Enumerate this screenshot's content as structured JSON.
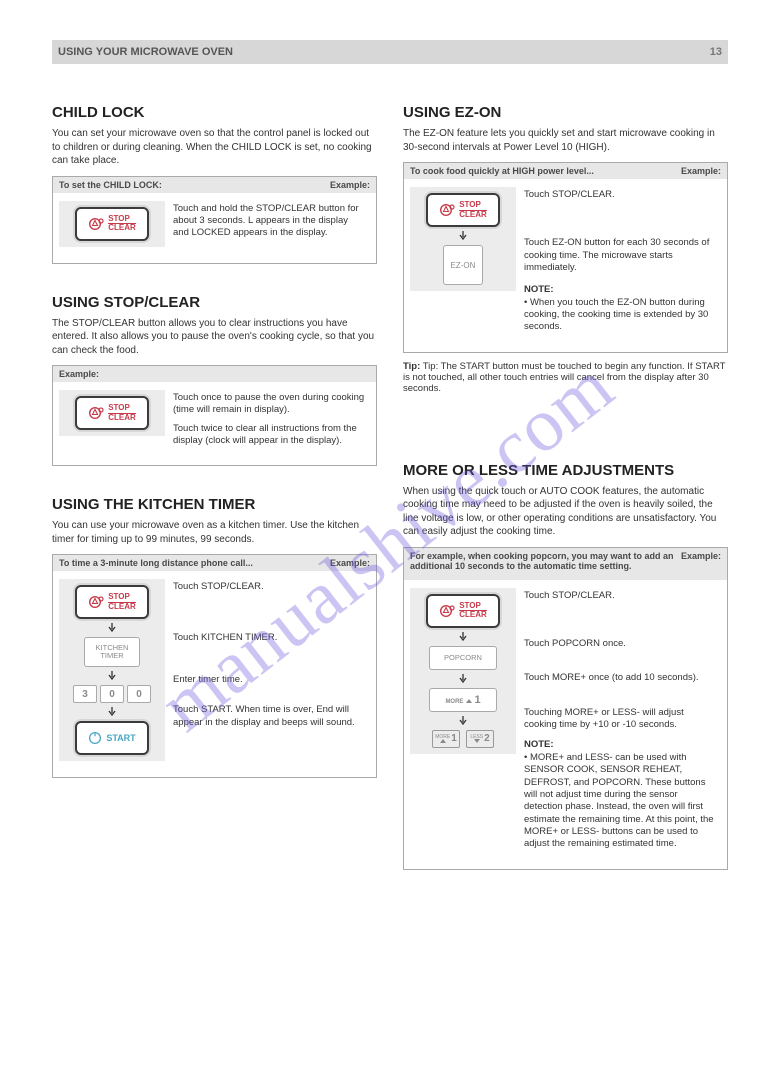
{
  "topbar": {
    "section": "USING YOUR MICROWAVE OVEN",
    "page": "13"
  },
  "watermark": "manualshive.com",
  "col1": {
    "h_child": "CHILD LOCK",
    "p_child": "You can set your microwave oven so that the control panel is locked out to children or during cleaning. When the CHILD LOCK is set, no cooking can take place.",
    "child_set": {
      "hd_l": "To set the CHILD LOCK:",
      "hd_r": "Example:",
      "body": "Touch and hold the STOP/CLEAR button for about 3 seconds. L appears in the display and LOCKED appears in the display."
    },
    "h_cancel": "USING STOP/CLEAR",
    "p_cancel": "The STOP/CLEAR button allows you to clear instructions you have entered. It also allows you to pause the oven's cooking cycle, so that you can check the food.",
    "cancel": {
      "hd_l": "Example:",
      "hd_r": "",
      "l1": "Touch once to pause the oven during cooking (time will remain in display).",
      "l2": "Touch twice to clear all instructions from the display (clock will appear in the display)."
    },
    "h_timer": "USING THE KITCHEN TIMER",
    "p_timer": "You can use your microwave oven as a kitchen timer. Use the kitchen timer for timing up to 99 minutes, 99 seconds.",
    "timer": {
      "hd_l": "To time a 3-minute long distance phone call...",
      "hd_r": "Example:",
      "s1": "Touch STOP/CLEAR.",
      "s2": "Touch KITCHEN TIMER.",
      "s3": "Enter timer time.",
      "s4": "Touch START. When time is over, End will appear in the display and beeps will sound."
    },
    "start_tip": "Tip: The START button must be touched to begin any function. If START is not touched, all other touch entries will cancel from the display after 30 seconds.",
    "btn": {
      "stop": "STOP",
      "clear": "CLEAR",
      "kitchen": "KITCHEN\nTIMER",
      "start": "START",
      "k3": "3",
      "k0a": "0",
      "k0b": "0"
    }
  },
  "col2": {
    "h_ez": "USING EZ-ON",
    "p_ez": "The EZ-ON feature lets you quickly set and start microwave cooking in 30-second intervals at Power Level 10 (HIGH).",
    "ez": {
      "hd_l": "To cook food quickly at HIGH power level...",
      "hd_r": "Example:",
      "s1": "Touch STOP/CLEAR.",
      "s2": "Touch EZ-ON button for each 30 seconds of cooking time. The microwave starts immediately.",
      "note1": "NOTE:",
      "note1b": "• When you touch the EZ-ON button during cooking, the cooking time is extended by 30 seconds."
    },
    "btn_ez": "EZ-ON",
    "h_ml": "MORE OR LESS TIME ADJUSTMENTS",
    "p_ml": "When using the quick touch or AUTO COOK features, the automatic cooking time may need to be adjusted if the oven is heavily soiled, the line voltage is low, or other operating conditions are unsatisfactory. You can easily adjust the cooking time.",
    "ml": {
      "hd_l": "For example, when cooking popcorn, you may want to add an additional 10 seconds to the automatic time setting.",
      "hd_r": "Example:",
      "s1": "Touch STOP/CLEAR.",
      "s2": "Touch POPCORN once.",
      "s3": "Touch MORE+ once (to add 10 seconds).",
      "s4": "Touching MORE+ or LESS- will adjust cooking time by +10 or -10 seconds.",
      "note": "NOTE:",
      "noteb": "• MORE+ and LESS- can be used with SENSOR COOK, SENSOR REHEAT, DEFROST, and POPCORN. These buttons will not adjust time during the sensor detection phase. Instead, the oven will first estimate the remaining time. At this point, the MORE+ or LESS- buttons can be used to adjust the remaining estimated time."
    },
    "btn_pop": "POPCORN",
    "btn_more": {
      "lab": "MORE",
      "num": "1"
    },
    "btn_more2": {
      "lab": "MORE",
      "num": "1"
    },
    "btn_less": {
      "lab": "LESS",
      "num": "2"
    }
  }
}
